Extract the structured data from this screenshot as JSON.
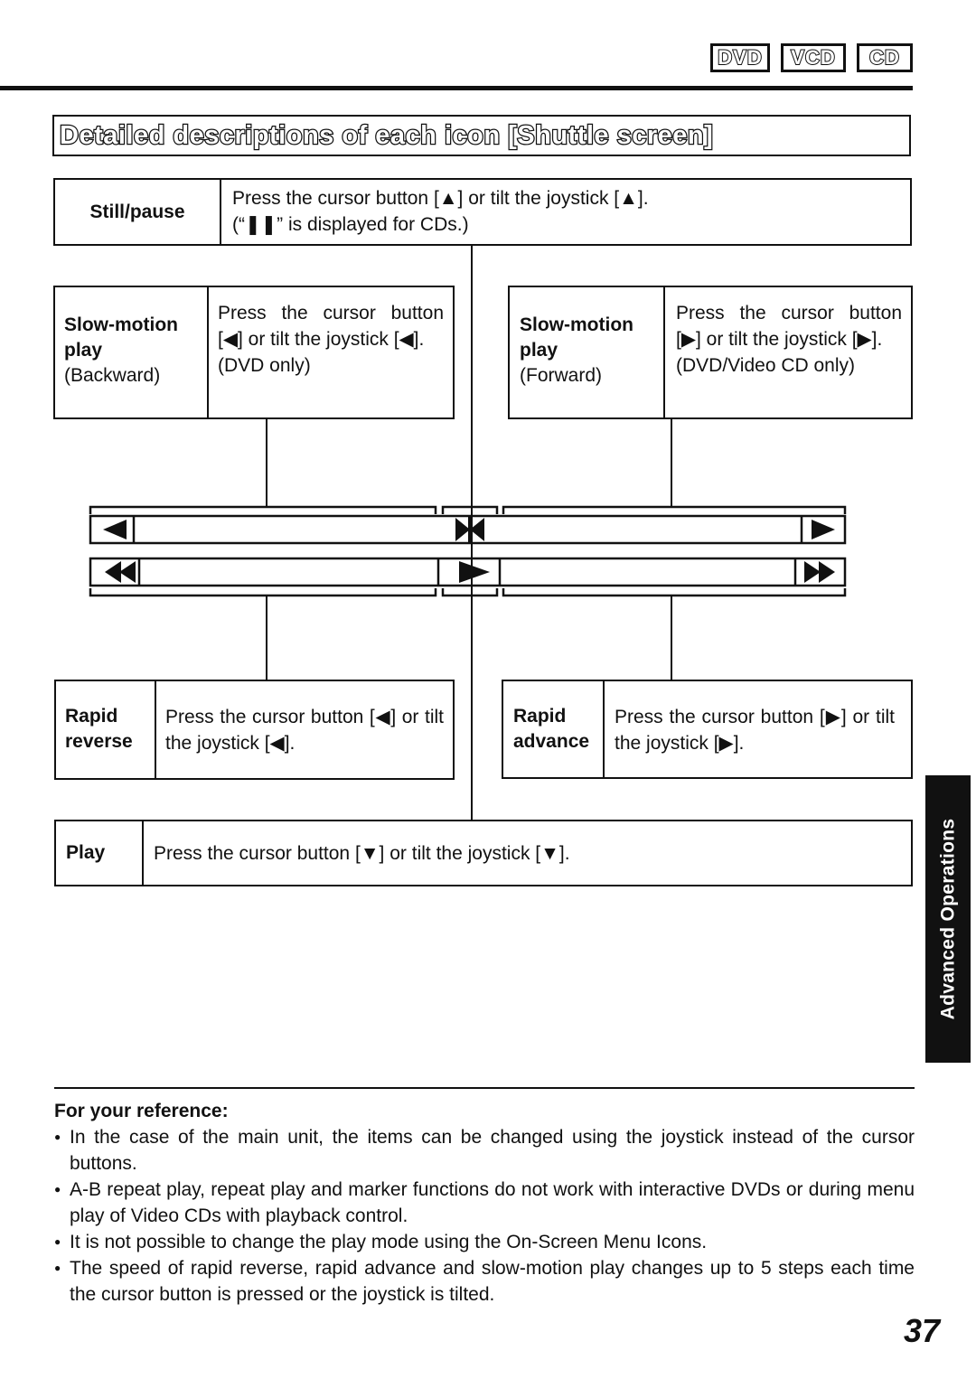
{
  "header": {
    "disc_badges": [
      "DVD",
      "VCD",
      "CD"
    ]
  },
  "section_title": "Detailed descriptions of each icon [Shuttle screen]",
  "still_pause": {
    "label": "Still/pause",
    "line1": "Press the cursor button [▲] or tilt the joystick [▲].",
    "line2": "(“❚❚” is displayed for CDs.)"
  },
  "slow_backward": {
    "label_bold": "Slow-motion play",
    "label_sub": "(Backward)",
    "desc": "Press the cursor button [◀] or tilt the joystick [◀].",
    "note": "(DVD only)"
  },
  "slow_forward": {
    "label_bold": "Slow-motion play",
    "label_sub": "(Forward)",
    "desc": "Press the cursor button [▶] or tilt the joystick [▶].",
    "note": "(DVD/Video CD only)"
  },
  "shuttle_icons": {
    "top_row": [
      "slow-backward",
      "still-pause",
      "slow-forward"
    ],
    "bottom_row": [
      "rapid-reverse",
      "play",
      "rapid-advance"
    ]
  },
  "rapid_reverse": {
    "label_line1": "Rapid",
    "label_line2": "reverse",
    "desc": "Press the cursor button [◀] or tilt the joystick [◀]."
  },
  "rapid_advance": {
    "label_line1": "Rapid",
    "label_line2": "advance",
    "desc": "Press the cursor button [▶] or tilt the joystick [▶]."
  },
  "play": {
    "label": "Play",
    "desc": "Press the cursor button [▼] or tilt the joystick [▼]."
  },
  "side_tab": "Advanced Operations",
  "reference": {
    "heading": "For your reference:",
    "items": [
      "In the case of the main unit, the items can be changed using the joystick instead of the cursor buttons.",
      "A-B repeat play, repeat play and marker functions do not work with interactive DVDs or during menu play of Video CDs with playback control.",
      "It is not possible to change the play mode using the On-Screen Menu Icons.",
      "The speed of rapid reverse, rapid advance and slow-motion play changes up to 5 steps each time the cursor button is pressed or the joystick is tilted."
    ]
  },
  "page_number": "37"
}
